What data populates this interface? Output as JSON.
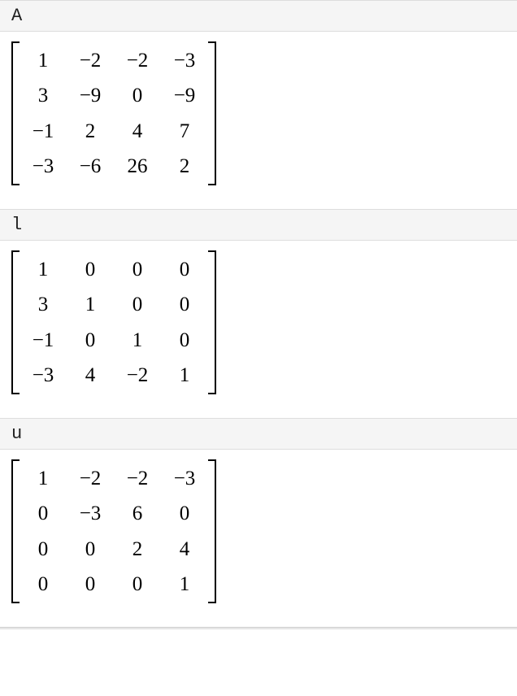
{
  "sections": {
    "A": {
      "label": "A",
      "matrix": [
        [
          "1",
          "−2",
          "−2",
          "−3"
        ],
        [
          "3",
          "−9",
          "0",
          "−9"
        ],
        [
          "−1",
          "2",
          "4",
          "7"
        ],
        [
          "−3",
          "−6",
          "26",
          "2"
        ]
      ]
    },
    "l": {
      "label": "l",
      "matrix": [
        [
          "1",
          "0",
          "0",
          "0"
        ],
        [
          "3",
          "1",
          "0",
          "0"
        ],
        [
          "−1",
          "0",
          "1",
          "0"
        ],
        [
          "−3",
          "4",
          "−2",
          "1"
        ]
      ]
    },
    "u": {
      "label": "u",
      "matrix": [
        [
          "1",
          "−2",
          "−2",
          "−3"
        ],
        [
          "0",
          "−3",
          "6",
          "0"
        ],
        [
          "0",
          "0",
          "2",
          "4"
        ],
        [
          "0",
          "0",
          "0",
          "1"
        ]
      ]
    }
  },
  "order": [
    "A",
    "l",
    "u"
  ],
  "chart_data": [
    {
      "type": "table",
      "title": "A",
      "values": [
        [
          1,
          -2,
          -2,
          -3
        ],
        [
          3,
          -9,
          0,
          -9
        ],
        [
          -1,
          2,
          4,
          7
        ],
        [
          -3,
          -6,
          26,
          2
        ]
      ]
    },
    {
      "type": "table",
      "title": "l",
      "values": [
        [
          1,
          0,
          0,
          0
        ],
        [
          3,
          1,
          0,
          0
        ],
        [
          -1,
          0,
          1,
          0
        ],
        [
          -3,
          4,
          -2,
          1
        ]
      ]
    },
    {
      "type": "table",
      "title": "u",
      "values": [
        [
          1,
          -2,
          -2,
          -3
        ],
        [
          0,
          -3,
          6,
          0
        ],
        [
          0,
          0,
          2,
          4
        ],
        [
          0,
          0,
          0,
          1
        ]
      ]
    }
  ]
}
